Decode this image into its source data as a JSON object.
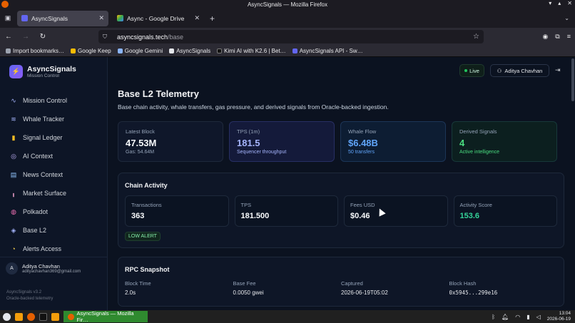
{
  "window": {
    "title": "AsyncSignals — Mozilla Firefox"
  },
  "tabs": [
    {
      "label": "AsyncSignals",
      "active": true
    },
    {
      "label": "Async - Google Drive",
      "active": false
    }
  ],
  "url": {
    "host": "asyncsignals.tech",
    "path": "/base"
  },
  "bookmarks": [
    "Import bookmarks…",
    "Google Keep",
    "Google Gemini",
    "AsyncSignals",
    "Kimi AI with K2.6 | Bet…",
    "AsyncSignals API - Sw…"
  ],
  "brand": {
    "name": "AsyncSignals",
    "subtitle": "Mission Control"
  },
  "nav": [
    {
      "label": "Mission Control",
      "icon": "activity-icon"
    },
    {
      "label": "Whale Tracker",
      "icon": "waves-icon"
    },
    {
      "label": "Signal Ledger",
      "icon": "bar-chart-icon"
    },
    {
      "label": "AI Context",
      "icon": "brain-icon"
    },
    {
      "label": "News Context",
      "icon": "newspaper-icon"
    },
    {
      "label": "Market Surface",
      "icon": "chart-icon"
    },
    {
      "label": "Polkadot",
      "icon": "globe-icon"
    },
    {
      "label": "Base L2",
      "icon": "layers-icon"
    },
    {
      "label": "Alerts Access",
      "icon": "bell-icon"
    }
  ],
  "user": {
    "initial": "A",
    "name": "Aditya Chavhan",
    "email": "adityachavhan369@gmail.com"
  },
  "version": {
    "line1": "AsyncSignals v3.2",
    "line2": "Oracle-backed telemetry"
  },
  "topbar": {
    "live": "Live",
    "user": "Aditya Chavhan"
  },
  "page": {
    "title": "Base L2 Telemetry",
    "description": "Base chain activity, whale transfers, gas pressure, and derived signals from Oracle-backed ingestion."
  },
  "stats": [
    {
      "label": "Latest Block",
      "value": "47.53M",
      "sub": "Gas: 54.64M"
    },
    {
      "label": "TPS (1m)",
      "value": "181.5",
      "sub": "Sequencer throughput"
    },
    {
      "label": "Whale Flow",
      "value": "$6.48B",
      "sub": "50 transfers"
    },
    {
      "label": "Derived Signals",
      "value": "4",
      "sub": "Active intelligence"
    }
  ],
  "chain_activity": {
    "title": "Chain Activity",
    "metrics": [
      {
        "label": "Transactions",
        "value": "363"
      },
      {
        "label": "TPS",
        "value": "181.500"
      },
      {
        "label": "Fees USD",
        "value": "$0.46"
      },
      {
        "label": "Activity Score",
        "value": "153.6"
      }
    ],
    "alert": "LOW ALERT"
  },
  "rpc": {
    "title": "RPC Snapshot",
    "fields": [
      {
        "label": "Block Time",
        "value": "2.0s"
      },
      {
        "label": "Base Fee",
        "value": "0.0050 gwei"
      },
      {
        "label": "Captured",
        "value": "2026-06-19T05:02"
      },
      {
        "label": "Block Hash",
        "value": "0x5945...299e16"
      }
    ]
  },
  "taskbar": {
    "task": "AsyncSignals — Mozilla Fir…",
    "time": "13:04",
    "date": "2026-06-19"
  },
  "colors": {
    "accent": "#6366f1",
    "live": "#22c55e",
    "blue": "#60a5fa",
    "green": "#4ade80"
  }
}
